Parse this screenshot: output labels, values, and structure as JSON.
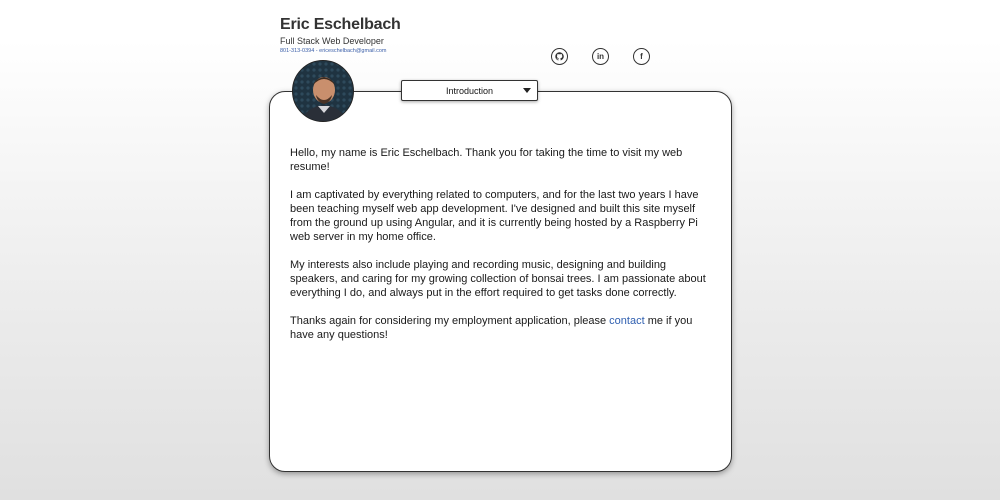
{
  "header": {
    "name": "Eric Eschelbach",
    "title": "Full Stack Web Developer",
    "phone": "801-313-0394",
    "separator": " - ",
    "email": "ericeschelbach@gmail.com"
  },
  "social": [
    {
      "icon": "github-icon",
      "glyph": "♉"
    },
    {
      "icon": "linkedin-icon",
      "glyph": "in"
    },
    {
      "icon": "facebook-icon",
      "glyph": "f"
    }
  ],
  "section_select": {
    "selected": "Introduction"
  },
  "content": {
    "p1": "Hello, my name is Eric Eschelbach. Thank you for taking the time to visit my web resume!",
    "p2": "I am captivated by everything related to computers, and for the last two years I have been teaching myself web app development. I've designed and built this site myself from the ground up using Angular, and it is currently being hosted by a Raspberry Pi web server in my home office.",
    "p3": "My interests also include playing and recording music, designing and building speakers, and caring for my growing collection of bonsai trees. I am passionate about everything I do, and always put in the effort required to get tasks done correctly.",
    "p4_before": "Thanks again for considering my employment application, please ",
    "p4_link": "contact",
    "p4_after": " me if you have any questions!"
  },
  "colors": {
    "link": "#2f5fb0",
    "border": "#333333"
  }
}
